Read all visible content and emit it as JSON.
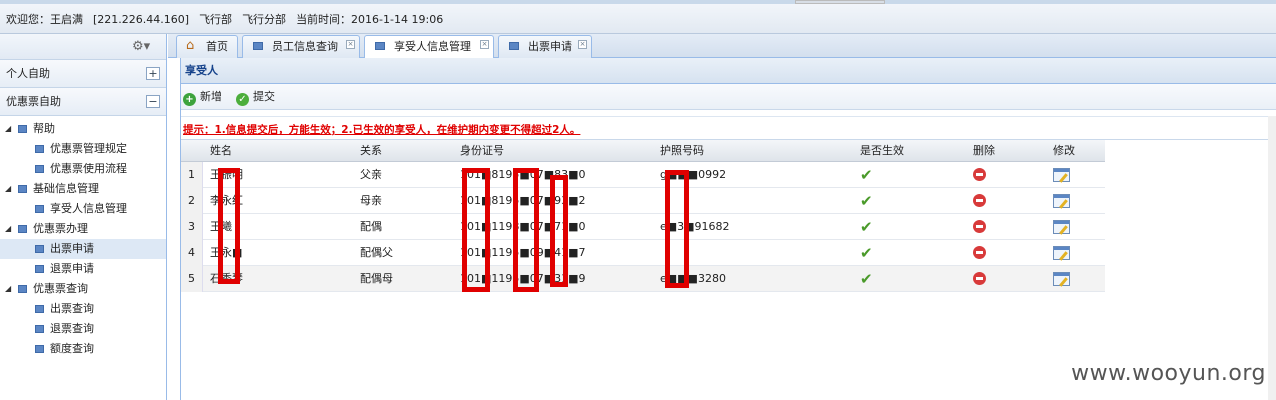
{
  "header": {
    "welcome": "欢迎您：王启满",
    "ip": "[221.226.44.160]",
    "dept1": "飞行部",
    "dept2": "飞行分部",
    "time_label": "当前时间：2016-1-14 19:06"
  },
  "sidebar": {
    "sections": [
      {
        "label": "个人自助",
        "toggle": "+"
      },
      {
        "label": "优惠票自助",
        "toggle": "−"
      }
    ],
    "tree": [
      {
        "label": "帮助",
        "level": 1
      },
      {
        "label": "优惠票管理规定",
        "level": 2
      },
      {
        "label": "优惠票使用流程",
        "level": 2
      },
      {
        "label": "基础信息管理",
        "level": 1
      },
      {
        "label": "享受人信息管理",
        "level": 2
      },
      {
        "label": "优惠票办理",
        "level": 1
      },
      {
        "label": "出票申请",
        "level": 2,
        "selected": true
      },
      {
        "label": "退票申请",
        "level": 2
      },
      {
        "label": "优惠票查询",
        "level": 1
      },
      {
        "label": "出票查询",
        "level": 2
      },
      {
        "label": "退票查询",
        "level": 2
      },
      {
        "label": "额度查询",
        "level": 2
      }
    ]
  },
  "tabs": [
    {
      "label": "首页",
      "icon": "home-icon",
      "closable": false
    },
    {
      "label": "员工信息查询",
      "icon": "page-icon",
      "closable": true
    },
    {
      "label": "享受人信息管理",
      "icon": "page-icon",
      "closable": true,
      "active": true
    },
    {
      "label": "出票申请",
      "icon": "page-icon",
      "closable": true
    }
  ],
  "panel": {
    "title": "享受人",
    "toolbar": {
      "add_label": "新增",
      "submit_label": "提交"
    },
    "notice": "提示：1.信息提交后，方能生效；2.已生效的享受人，在维护期内变更不得超过2人。"
  },
  "grid": {
    "columns": [
      "姓名",
      "关系",
      "身份证号",
      "护照号码",
      "是否生效",
      "删除",
      "修改"
    ],
    "rows": [
      {
        "no": "1",
        "name": "王振明",
        "relation": "父亲",
        "id_no": "101■8195■07■83■0",
        "passport": "g■■■0992"
      },
      {
        "no": "2",
        "name": "李永红",
        "relation": "母亲",
        "id_no": "101■8195■07■93■2",
        "passport": ""
      },
      {
        "no": "3",
        "name": "王曦",
        "relation": "配偶",
        "id_no": "101■1198■07■71■0",
        "passport": "e■3■91682"
      },
      {
        "no": "4",
        "name": "王永■",
        "relation": "配偶父",
        "id_no": "101■1195■09■41■7",
        "passport": ""
      },
      {
        "no": "5",
        "name": "石秀琴",
        "relation": "配偶母",
        "id_no": "101■1195■07■31■9",
        "passport": "e■■■3280"
      }
    ]
  },
  "watermark": "www.wooyun.org",
  "colors": {
    "accent": "#15428b",
    "border": "#99bbe8",
    "notice": "#e00000",
    "redaction": "#e00000"
  }
}
